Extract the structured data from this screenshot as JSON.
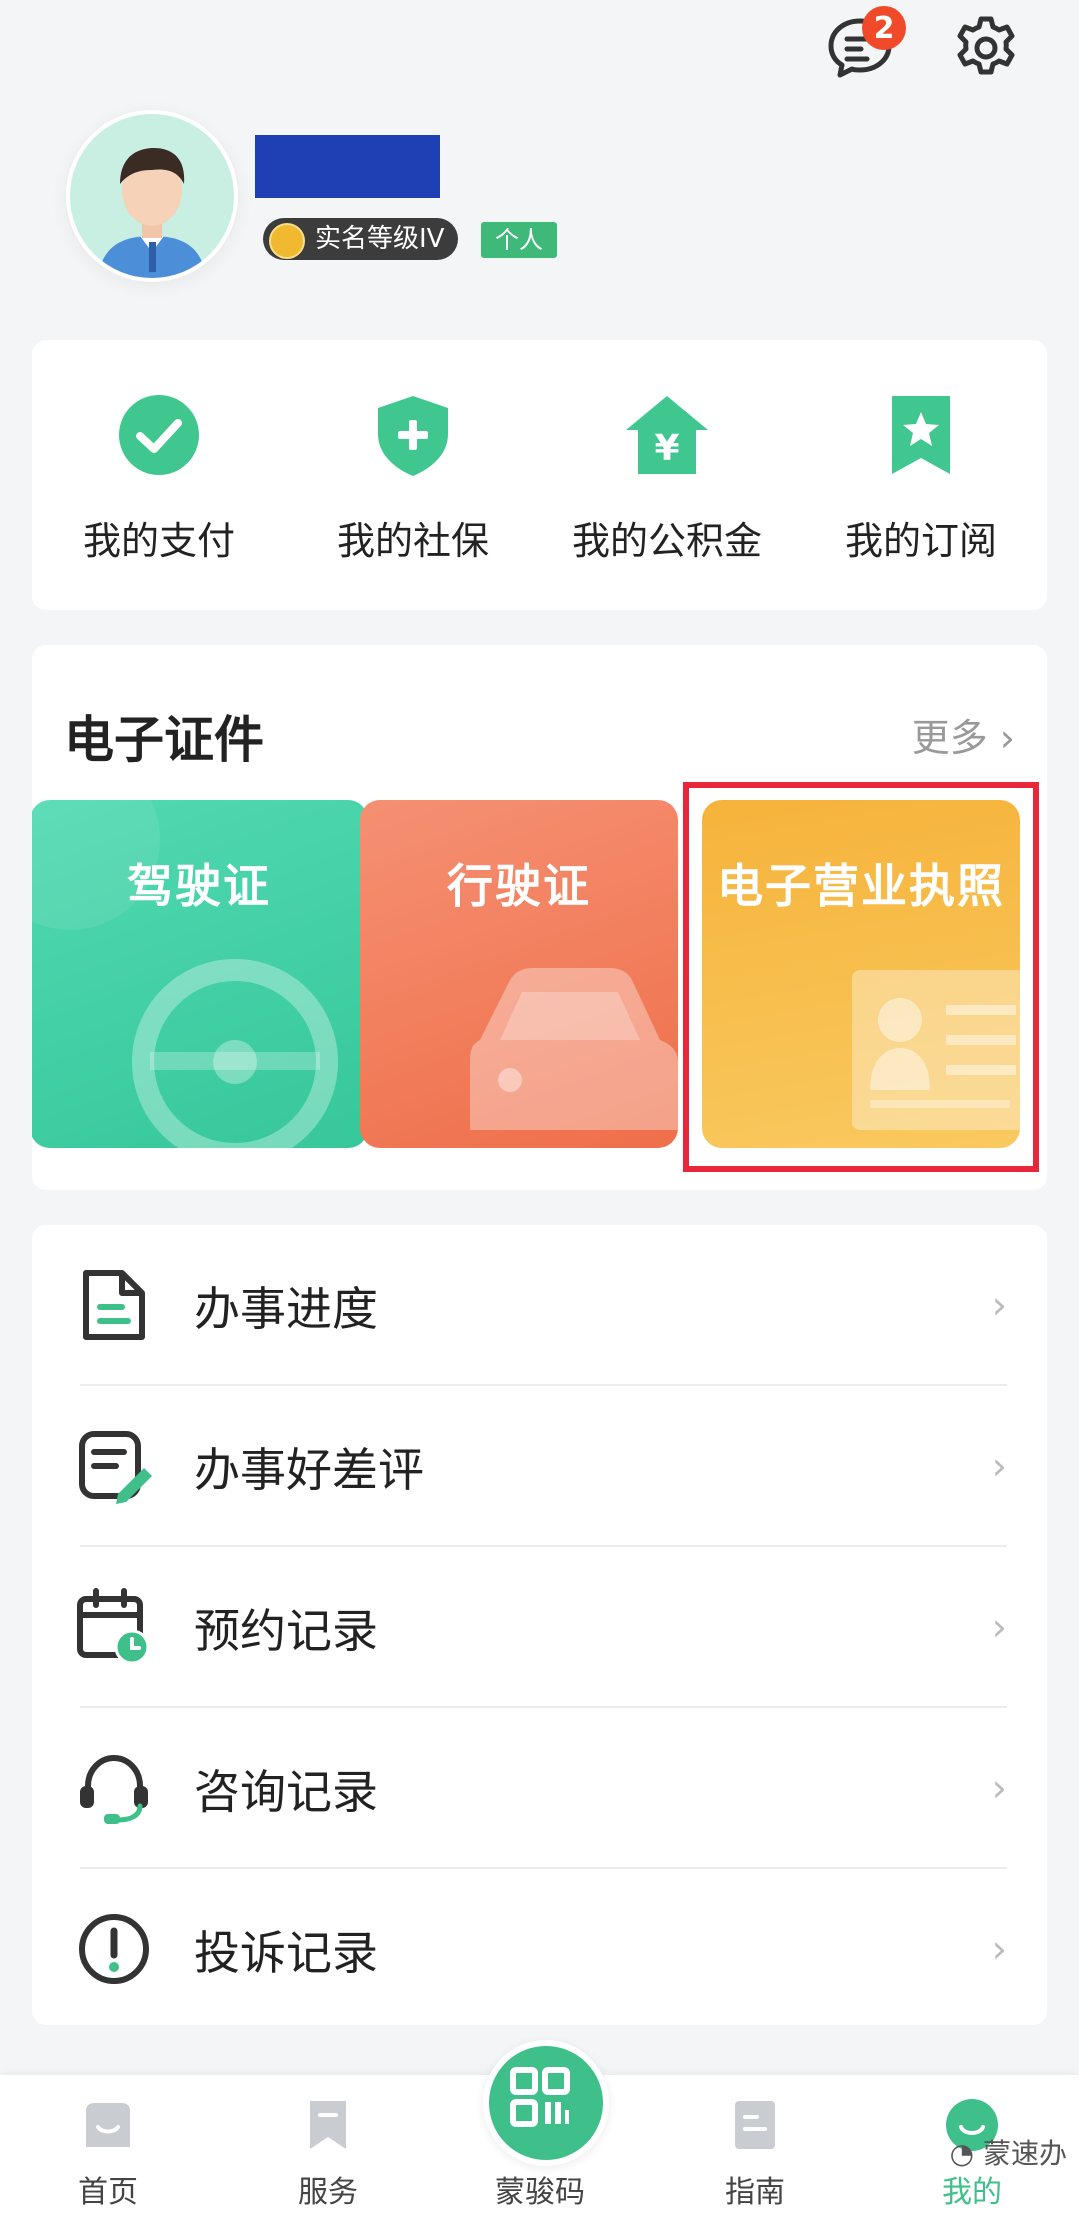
{
  "header": {
    "message_badge": "2",
    "message_icon": "message-icon",
    "settings_icon": "gear-icon"
  },
  "profile": {
    "level_label": "实名等级IV",
    "type_tag": "个人"
  },
  "quick_links": [
    {
      "label": "我的支付",
      "icon": "check-circle-icon"
    },
    {
      "label": "我的社保",
      "icon": "shield-plus-icon"
    },
    {
      "label": "我的公积金",
      "icon": "house-yuan-icon"
    },
    {
      "label": "我的订阅",
      "icon": "bookmark-star-icon"
    }
  ],
  "certificates": {
    "title": "电子证件",
    "more": "更多",
    "items": [
      {
        "label": "驾驶证",
        "color": "#3fd0a8"
      },
      {
        "label": "行驶证",
        "color": "#f27b57"
      },
      {
        "label": "电子营业执照",
        "color": "#f6b63e"
      }
    ]
  },
  "menu": [
    {
      "label": "办事进度",
      "icon": "document-icon"
    },
    {
      "label": "办事好差评",
      "icon": "review-edit-icon"
    },
    {
      "label": "预约记录",
      "icon": "calendar-clock-icon"
    },
    {
      "label": "咨询记录",
      "icon": "headset-icon"
    },
    {
      "label": "投诉记录",
      "icon": "exclamation-circle-icon"
    }
  ],
  "nav": {
    "home": "首页",
    "service": "服务",
    "code": "蒙骏码",
    "guide": "指南",
    "mine": "我的",
    "watermark": "蒙速办"
  },
  "colors": {
    "accent": "#3fbf8a",
    "highlight": "#e8283a"
  }
}
